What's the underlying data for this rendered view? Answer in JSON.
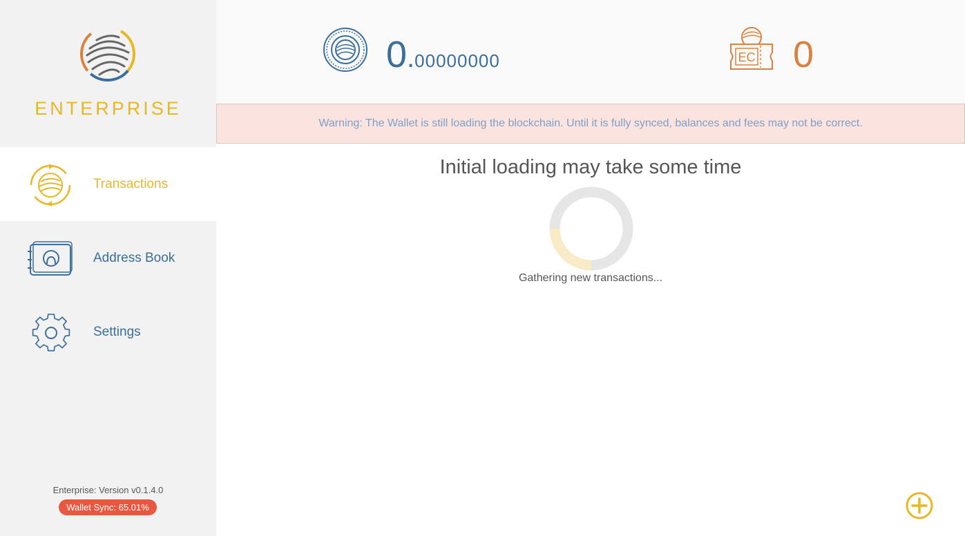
{
  "app": {
    "name": "ENTERPRISE",
    "brand_color": "#e8b724",
    "accent_blue": "#3b6e9a",
    "ec_color": "#d9823f"
  },
  "sidebar": {
    "items": [
      {
        "label": "Transactions",
        "icon": "transactions-globe-icon",
        "active": true
      },
      {
        "label": "Address Book",
        "icon": "address-book-icon",
        "active": false
      },
      {
        "label": "Settings",
        "icon": "gear-icon",
        "active": false
      }
    ],
    "version": "Enterprise: Version v0.1.4.0",
    "sync_status": "Wallet Sync: 65.01%",
    "sync_percent": 65.01
  },
  "header": {
    "fct_balance_int": "0",
    "fct_balance_dot": ".",
    "fct_balance_dec": "00000000",
    "ec_balance": "0",
    "ec_icon_label": "EC"
  },
  "warning": {
    "text": "Warning: The Wallet is still loading the blockchain. Until it is fully synced, balances and fees may not be correct."
  },
  "main": {
    "title": "Initial loading may take some time",
    "status": "Gathering new transactions...",
    "progress_fraction": 0.25
  }
}
